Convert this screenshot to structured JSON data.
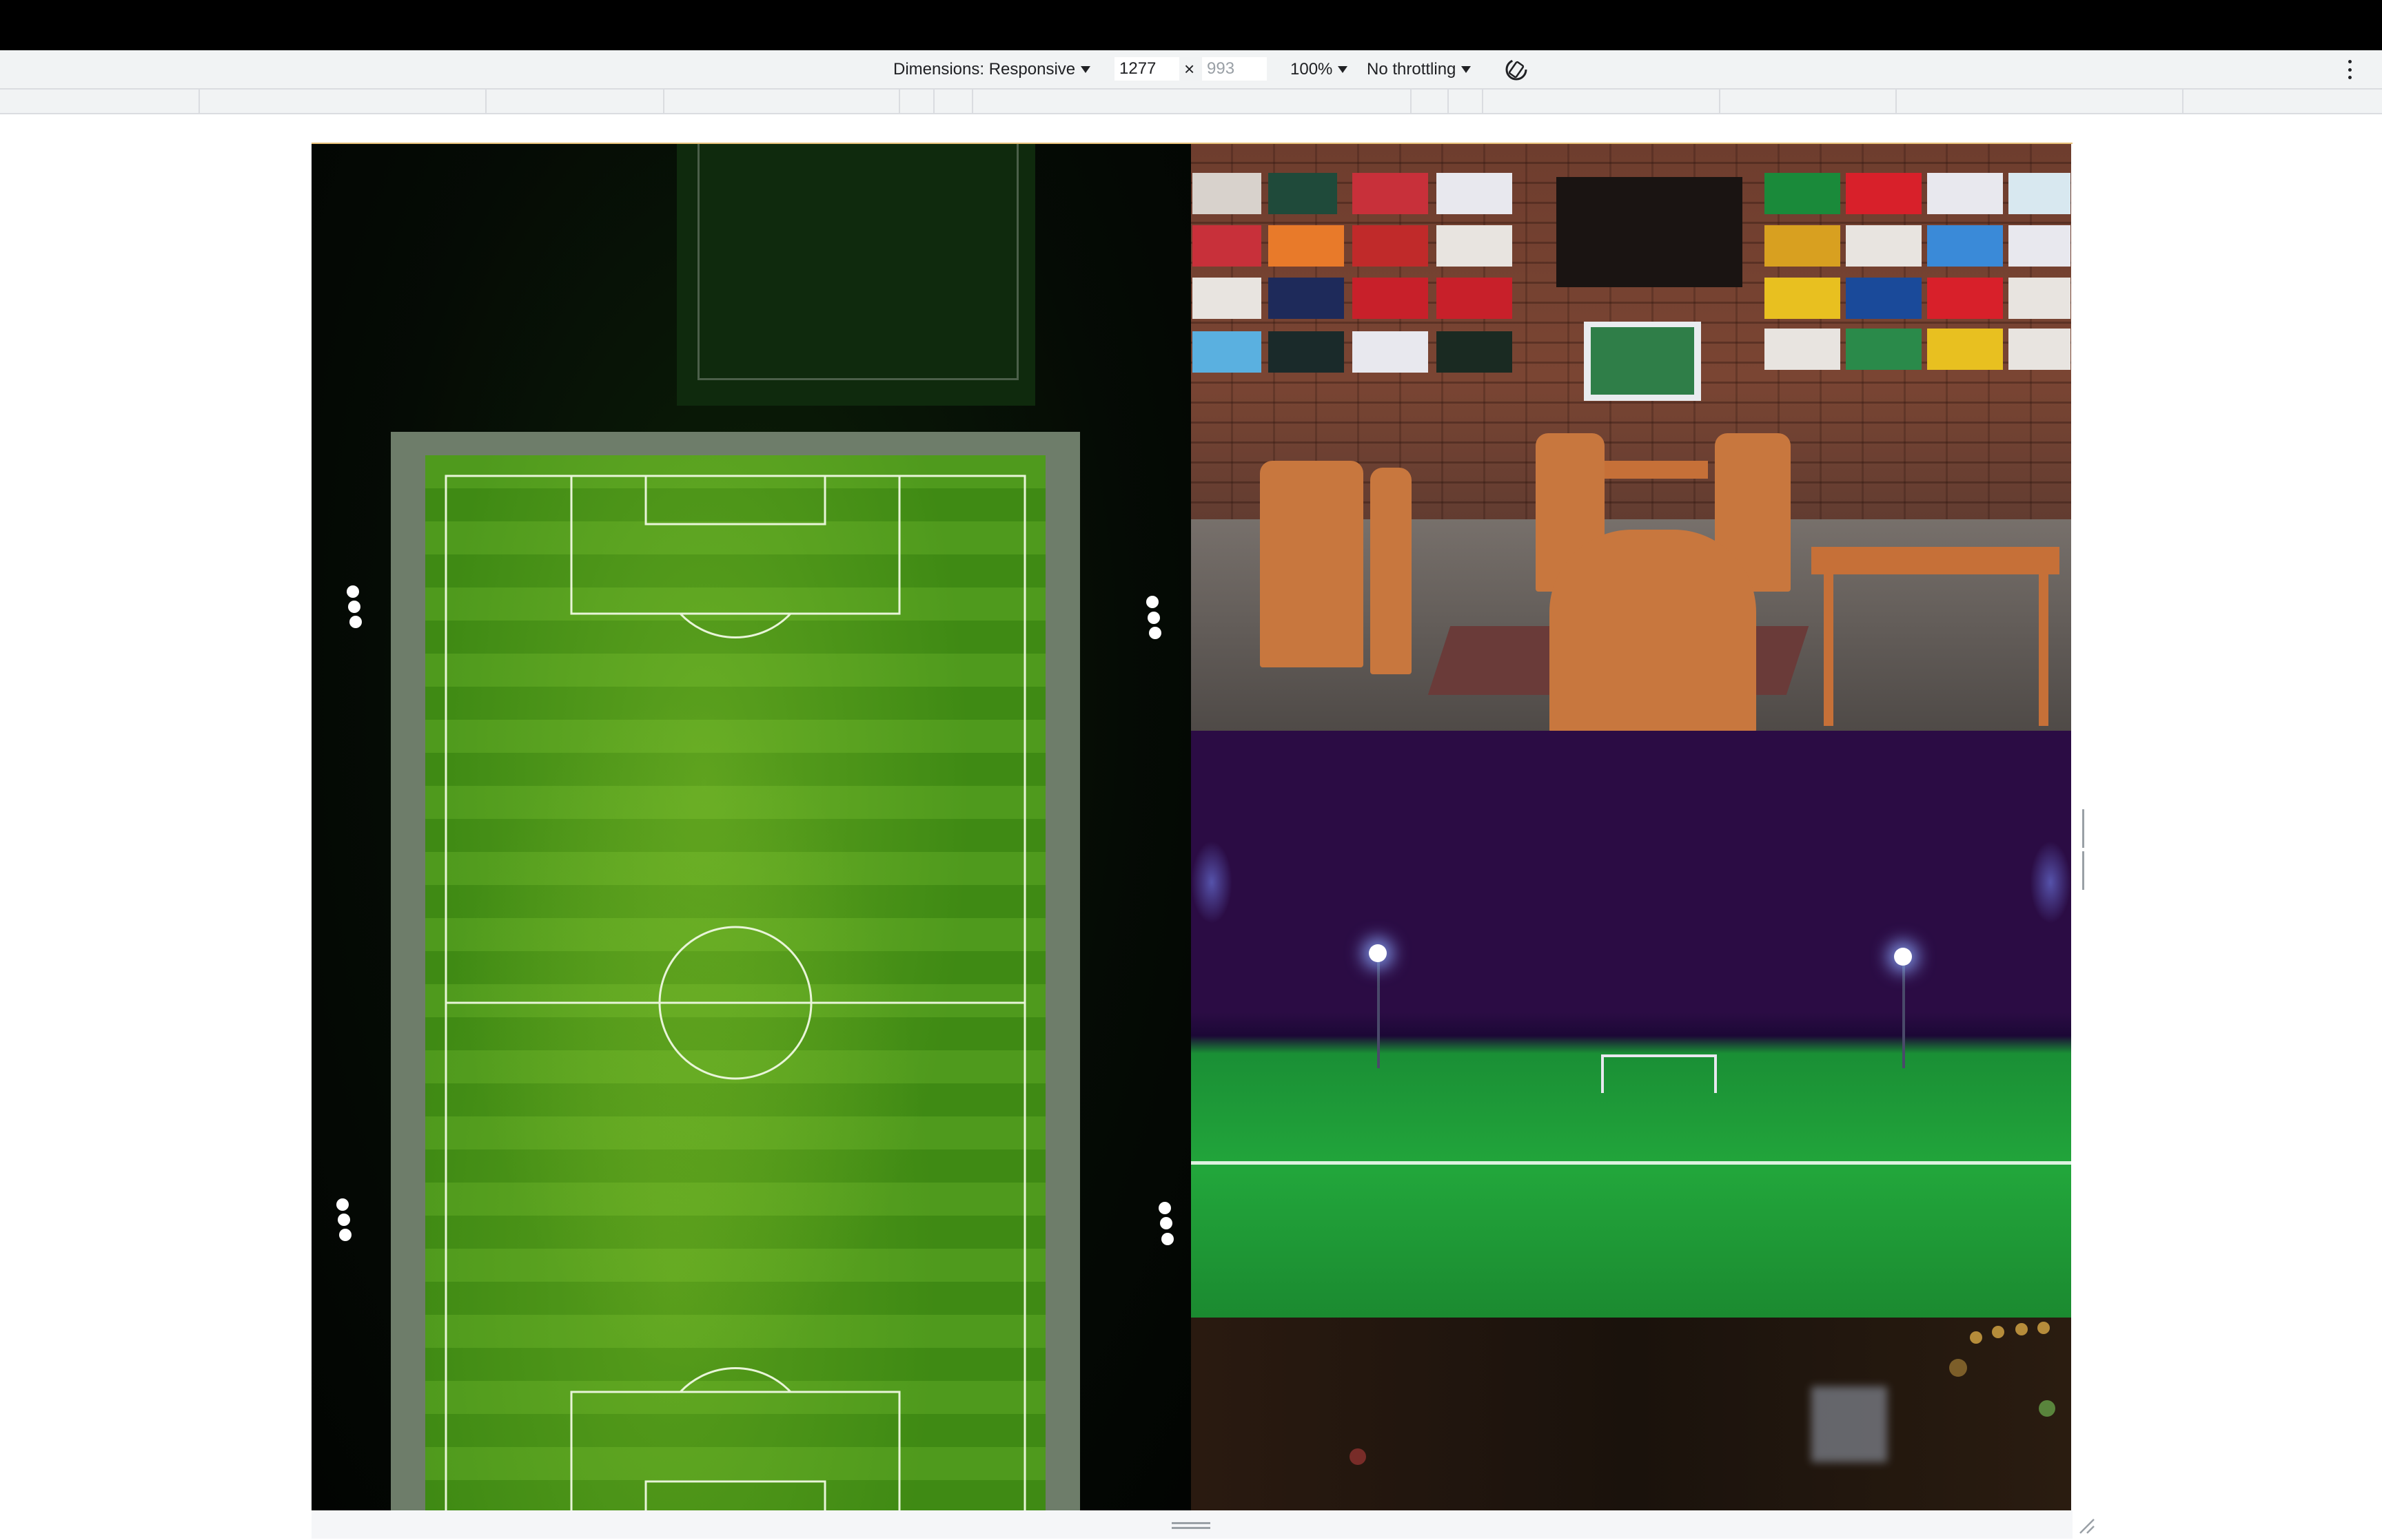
{
  "device_toolbar": {
    "dimensions_label": "Dimensions: Responsive",
    "width_value": "1277",
    "times_symbol": "×",
    "height_placeholder": "993",
    "zoom_label": "100%",
    "throttling_label": "No throttling",
    "rotate_icon": "rotate-icon",
    "more_icon": "kebab-menu-icon"
  },
  "viewport": {
    "images": [
      {
        "subject": "aerial-stadium-night"
      },
      {
        "subject": "cafe-with-flag-clocks"
      },
      {
        "subject": "football-field-night-lights"
      },
      {
        "subject": "dark-bar-bokeh"
      }
    ]
  },
  "colors": {
    "toolbar_bg": "#f1f3f4",
    "frame_accent": "#e8c27a",
    "night_sky": "#2b0c44",
    "grass": "#22a63b"
  }
}
